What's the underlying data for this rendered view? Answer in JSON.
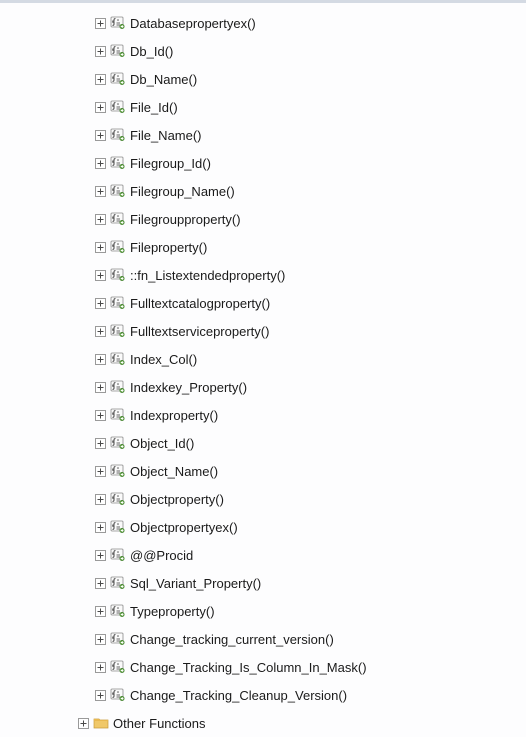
{
  "tree": {
    "functions": [
      {
        "label": "Databasepropertyex()"
      },
      {
        "label": "Db_Id()"
      },
      {
        "label": "Db_Name()"
      },
      {
        "label": "File_Id()"
      },
      {
        "label": "File_Name()"
      },
      {
        "label": "Filegroup_Id()"
      },
      {
        "label": "Filegroup_Name()"
      },
      {
        "label": "Filegroupproperty()"
      },
      {
        "label": "Fileproperty()"
      },
      {
        "label": "::fn_Listextendedproperty()"
      },
      {
        "label": "Fulltextcatalogproperty()"
      },
      {
        "label": "Fulltextserviceproperty()"
      },
      {
        "label": "Index_Col()"
      },
      {
        "label": "Indexkey_Property()"
      },
      {
        "label": "Indexproperty()"
      },
      {
        "label": "Object_Id()"
      },
      {
        "label": "Object_Name()"
      },
      {
        "label": "Objectproperty()"
      },
      {
        "label": "Objectpropertyex()"
      },
      {
        "label": "@@Procid"
      },
      {
        "label": "Sql_Variant_Property()"
      },
      {
        "label": "Typeproperty()"
      },
      {
        "label": "Change_tracking_current_version()"
      },
      {
        "label": "Change_Tracking_Is_Column_In_Mask()"
      },
      {
        "label": "Change_Tracking_Cleanup_Version()"
      }
    ],
    "other_functions": {
      "label": "Other Functions"
    }
  }
}
